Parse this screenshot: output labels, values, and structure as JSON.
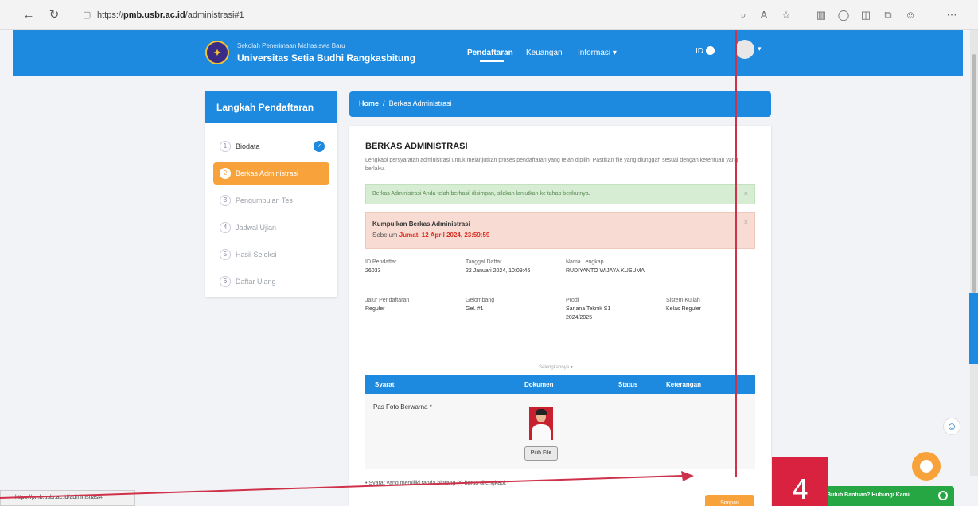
{
  "browser": {
    "url_prefix": "https://",
    "url_host": "pmb.usbr.ac.id",
    "url_path": "/administrasi#1"
  },
  "header": {
    "subtitle": "Sekolah Penerimaan Mahasiswa Baru",
    "title": "Universitas Setia Budhi Rangkasbitung",
    "nav": [
      "Pendaftaran",
      "Keuangan",
      "Informasi ▾"
    ],
    "lang": "ID"
  },
  "sidebar": {
    "title": "Langkah Pendaftaran",
    "steps": [
      {
        "num": "1",
        "label": "Biodata"
      },
      {
        "num": "2",
        "label": "Berkas Administrasi"
      },
      {
        "num": "3",
        "label": "Pengumpulan Tes"
      },
      {
        "num": "4",
        "label": "Jadwal Ujian"
      },
      {
        "num": "5",
        "label": "Hasil Seleksi"
      },
      {
        "num": "6",
        "label": "Daftar Ulang"
      }
    ]
  },
  "breadcrumb": {
    "home": "Home",
    "sep": "/",
    "current": "Berkas Administrasi"
  },
  "card": {
    "title": "BERKAS ADMINISTRASI",
    "desc": "Lengkapi persyaratan administrasi untuk melanjutkan proses pendaftaran yang telah dipilih. Pastikan file yang diunggah sesuai dengan ketentuan yang berlaku.",
    "alert_green": "Berkas Administrasi Anda telah berhasil disimpan, silakan lanjutkan ke tahap berikutnya.",
    "alert_red_title": "Kumpulkan Berkas Administrasi",
    "alert_red_prefix": "Sebelum ",
    "alert_red_deadline": "Jumat, 12 April 2024, 23:59:59",
    "info": [
      {
        "label": "ID Pendaftar",
        "value": "26033"
      },
      {
        "label": "Tanggal Daftar",
        "value": "22 Januari 2024, 10:09:46"
      },
      {
        "label": "Nama Lengkap",
        "value": "RUDIYANTO WIJAYA KUSUMA"
      },
      {
        "label": "Jalur Pendaftaran",
        "value": "Reguler"
      },
      {
        "label": "Gelombang",
        "value": "Gel. #1"
      },
      {
        "label": "Prodi",
        "value": "Sarjana Teknik S1",
        "value2": "2024/2025"
      },
      {
        "label": "Sistem Kuliah",
        "value": "Kelas Reguler"
      }
    ],
    "more_link": "Selengkapnya ▾",
    "table_headers": [
      "Syarat",
      "Dokumen",
      "Status",
      "Keterangan"
    ],
    "row_syarat": "Pas Foto Berwarna",
    "row_syarat_req": "*",
    "pilih_btn": "Pilih File",
    "foot_note": "Syarat yang memiliki tanda bintang (*) harus dilengkapi.",
    "foot_req": "*",
    "submit": "Simpan"
  },
  "widgets": {
    "wa_text": "Butuh Bantuan? Hubungi Kami",
    "status_url": "https://pmb.usbr.ac.id/administrasi#"
  },
  "annotation": {
    "number": "4",
    "color": "#d9223f"
  },
  "colors": {
    "primary": "#1d8ae0",
    "accent": "#f7a23a",
    "danger": "#d93025",
    "success": "#27a744"
  }
}
